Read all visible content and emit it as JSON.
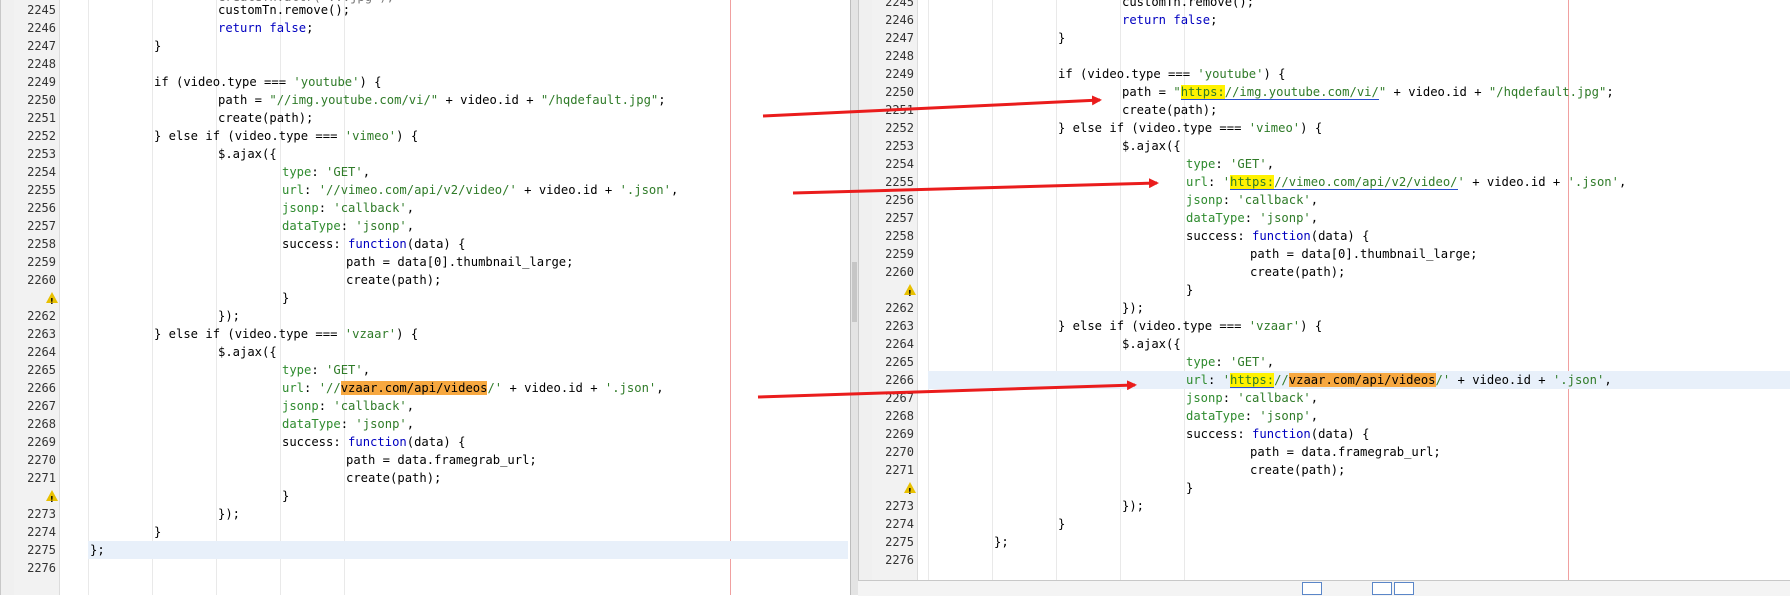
{
  "colors": {
    "keyword": "#0000c0",
    "string": "#2f7b28",
    "highlight_yellow": "#fff200",
    "highlight_orange": "#f7a840",
    "arrow": "#ea1c1c",
    "current_line": "#e8f0fa"
  },
  "left": {
    "top_partial": "createTn.attr('...jpg');",
    "lines": [
      {
        "n": "2245",
        "parts": [
          [
            "",
            "customTn.remove();"
          ]
        ],
        "indent": 2
      },
      {
        "n": "2246",
        "parts": [
          [
            "kw",
            "return false"
          ],
          [
            "",
            ";"
          ]
        ],
        "indent": 2
      },
      {
        "n": "2247",
        "parts": [
          [
            "",
            "}"
          ]
        ],
        "indent": 1
      },
      {
        "n": "2248",
        "parts": [],
        "indent": 0
      },
      {
        "n": "2249",
        "parts": [
          [
            "",
            "if (video.type === "
          ],
          [
            "str",
            "'youtube'"
          ],
          [
            "",
            ") {"
          ]
        ],
        "indent": 1
      },
      {
        "n": "2250",
        "parts": [
          [
            "",
            "path = "
          ],
          [
            "str",
            "\"//img.youtube.com/vi/\""
          ],
          [
            "",
            " + video.id + "
          ],
          [
            "str",
            "\"/hqdefault.jpg\""
          ],
          [
            "",
            ";"
          ]
        ],
        "indent": 2
      },
      {
        "n": "2251",
        "parts": [
          [
            "",
            "create(path);"
          ]
        ],
        "indent": 2
      },
      {
        "n": "2252",
        "parts": [
          [
            "",
            "} else if (video.type === "
          ],
          [
            "str",
            "'vimeo'"
          ],
          [
            "",
            ") {"
          ]
        ],
        "indent": 1
      },
      {
        "n": "2253",
        "parts": [
          [
            "",
            "$.ajax({"
          ]
        ],
        "indent": 2
      },
      {
        "n": "2254",
        "parts": [
          [
            "prop",
            "type"
          ],
          [
            "",
            ": "
          ],
          [
            "str",
            "'GET'"
          ],
          [
            "",
            ","
          ]
        ],
        "indent": 3
      },
      {
        "n": "2255",
        "parts": [
          [
            "prop",
            "url"
          ],
          [
            "",
            ": "
          ],
          [
            "str",
            "'//vimeo.com/api/v2/video/'"
          ],
          [
            "",
            " + video.id + "
          ],
          [
            "str",
            "'.json'"
          ],
          [
            "",
            ","
          ]
        ],
        "indent": 3
      },
      {
        "n": "2256",
        "parts": [
          [
            "prop",
            "jsonp"
          ],
          [
            "",
            ": "
          ],
          [
            "str",
            "'callback'"
          ],
          [
            "",
            ","
          ]
        ],
        "indent": 3
      },
      {
        "n": "2257",
        "parts": [
          [
            "prop",
            "dataType"
          ],
          [
            "",
            ": "
          ],
          [
            "str",
            "'jsonp'"
          ],
          [
            "",
            ","
          ]
        ],
        "indent": 3
      },
      {
        "n": "2258",
        "parts": [
          [
            "",
            "success: "
          ],
          [
            "kw",
            "function"
          ],
          [
            "",
            "(data) {"
          ]
        ],
        "indent": 3
      },
      {
        "n": "2259",
        "parts": [
          [
            "",
            "path = data[0].thumbnail_large;"
          ]
        ],
        "indent": 4
      },
      {
        "n": "2260",
        "parts": [
          [
            "",
            "create(path);"
          ]
        ],
        "indent": 4
      },
      {
        "n": "",
        "parts": [
          [
            "",
            "}"
          ]
        ],
        "indent": 3,
        "warn": true
      },
      {
        "n": "2262",
        "parts": [
          [
            "",
            "});"
          ]
        ],
        "indent": 2
      },
      {
        "n": "2263",
        "parts": [
          [
            "",
            "} else if (video.type === "
          ],
          [
            "str",
            "'vzaar'"
          ],
          [
            "",
            ") {"
          ]
        ],
        "indent": 1
      },
      {
        "n": "2264",
        "parts": [
          [
            "",
            "$.ajax({"
          ]
        ],
        "indent": 2
      },
      {
        "n": "2265",
        "parts": [
          [
            "prop",
            "type"
          ],
          [
            "",
            ": "
          ],
          [
            "str",
            "'GET'"
          ],
          [
            "",
            ","
          ]
        ],
        "indent": 3
      },
      {
        "n": "2266",
        "parts": [
          [
            "prop",
            "url"
          ],
          [
            "",
            ": "
          ],
          [
            "str",
            "'//"
          ],
          [
            "orange",
            "vzaar.com/api/videos"
          ],
          [
            "str",
            "/'"
          ],
          [
            "",
            " + video.id + "
          ],
          [
            "str",
            "'.json'"
          ],
          [
            "",
            ","
          ]
        ],
        "indent": 3
      },
      {
        "n": "2267",
        "parts": [
          [
            "prop",
            "jsonp"
          ],
          [
            "",
            ": "
          ],
          [
            "str",
            "'callback'"
          ],
          [
            "",
            ","
          ]
        ],
        "indent": 3
      },
      {
        "n": "2268",
        "parts": [
          [
            "prop",
            "dataType"
          ],
          [
            "",
            ": "
          ],
          [
            "str",
            "'jsonp'"
          ],
          [
            "",
            ","
          ]
        ],
        "indent": 3
      },
      {
        "n": "2269",
        "parts": [
          [
            "",
            "success: "
          ],
          [
            "kw",
            "function"
          ],
          [
            "",
            "(data) {"
          ]
        ],
        "indent": 3
      },
      {
        "n": "2270",
        "parts": [
          [
            "",
            "path = data.framegrab_url;"
          ]
        ],
        "indent": 4
      },
      {
        "n": "2271",
        "parts": [
          [
            "",
            "create(path);"
          ]
        ],
        "indent": 4
      },
      {
        "n": "",
        "parts": [
          [
            "",
            "}"
          ]
        ],
        "indent": 3,
        "warn": true
      },
      {
        "n": "2273",
        "parts": [
          [
            "",
            "});"
          ]
        ],
        "indent": 2
      },
      {
        "n": "2274",
        "parts": [
          [
            "",
            "}"
          ]
        ],
        "indent": 1
      },
      {
        "n": "2275",
        "parts": [
          [
            "",
            "};"
          ]
        ],
        "indent": 0,
        "current": true
      },
      {
        "n": "2276",
        "parts": [],
        "indent": 0
      }
    ]
  },
  "right": {
    "lines": [
      {
        "n": "2245",
        "parts": [
          [
            "",
            "customTn.remove();"
          ]
        ],
        "indent": 3
      },
      {
        "n": "2246",
        "parts": [
          [
            "kw",
            "return false"
          ],
          [
            "",
            ";"
          ]
        ],
        "indent": 3
      },
      {
        "n": "2247",
        "parts": [
          [
            "",
            "}"
          ]
        ],
        "indent": 2
      },
      {
        "n": "2248",
        "parts": [],
        "indent": 0
      },
      {
        "n": "2249",
        "parts": [
          [
            "",
            "if (video.type === "
          ],
          [
            "str",
            "'youtube'"
          ],
          [
            "",
            ") {"
          ]
        ],
        "indent": 2
      },
      {
        "n": "2250",
        "parts": [
          [
            "",
            "path = "
          ],
          [
            "str",
            "\""
          ],
          [
            "yellow",
            "https:"
          ],
          [
            "ulstr",
            "//img.youtube.com/vi/"
          ],
          [
            "str",
            "\""
          ],
          [
            "",
            " + video.id + "
          ],
          [
            "str",
            "\"/hqdefault.jpg\""
          ],
          [
            "",
            ";"
          ]
        ],
        "indent": 3
      },
      {
        "n": "2251",
        "parts": [
          [
            "",
            "create(path);"
          ]
        ],
        "indent": 3
      },
      {
        "n": "2252",
        "parts": [
          [
            "",
            "} else if (video.type === "
          ],
          [
            "str",
            "'vimeo'"
          ],
          [
            "",
            ") {"
          ]
        ],
        "indent": 2
      },
      {
        "n": "2253",
        "parts": [
          [
            "",
            "$.ajax({"
          ]
        ],
        "indent": 3
      },
      {
        "n": "2254",
        "parts": [
          [
            "prop",
            "type"
          ],
          [
            "",
            ": "
          ],
          [
            "str",
            "'GET'"
          ],
          [
            "",
            ","
          ]
        ],
        "indent": 4
      },
      {
        "n": "2255",
        "parts": [
          [
            "prop",
            "url"
          ],
          [
            "",
            ": "
          ],
          [
            "str",
            "'"
          ],
          [
            "yellow",
            "https:"
          ],
          [
            "ulstr",
            "//vimeo.com/api/v2/video/"
          ],
          [
            "str",
            "'"
          ],
          [
            "",
            " + video.id + "
          ],
          [
            "str",
            "'.json'"
          ],
          [
            "",
            ","
          ]
        ],
        "indent": 4
      },
      {
        "n": "2256",
        "parts": [
          [
            "prop",
            "jsonp"
          ],
          [
            "",
            ": "
          ],
          [
            "str",
            "'callback'"
          ],
          [
            "",
            ","
          ]
        ],
        "indent": 4
      },
      {
        "n": "2257",
        "parts": [
          [
            "prop",
            "dataType"
          ],
          [
            "",
            ": "
          ],
          [
            "str",
            "'jsonp'"
          ],
          [
            "",
            ","
          ]
        ],
        "indent": 4
      },
      {
        "n": "2258",
        "parts": [
          [
            "",
            "success: "
          ],
          [
            "kw",
            "function"
          ],
          [
            "",
            "(data) {"
          ]
        ],
        "indent": 4
      },
      {
        "n": "2259",
        "parts": [
          [
            "",
            "path = data[0].thumbnail_large;"
          ]
        ],
        "indent": 5
      },
      {
        "n": "2260",
        "parts": [
          [
            "",
            "create(path);"
          ]
        ],
        "indent": 5
      },
      {
        "n": "",
        "parts": [
          [
            "",
            "}"
          ]
        ],
        "indent": 4,
        "warn": true
      },
      {
        "n": "2262",
        "parts": [
          [
            "",
            "});"
          ]
        ],
        "indent": 3
      },
      {
        "n": "2263",
        "parts": [
          [
            "",
            "} else if (video.type === "
          ],
          [
            "str",
            "'vzaar'"
          ],
          [
            "",
            ") {"
          ]
        ],
        "indent": 2
      },
      {
        "n": "2264",
        "parts": [
          [
            "",
            "$.ajax({"
          ]
        ],
        "indent": 3
      },
      {
        "n": "2265",
        "parts": [
          [
            "prop",
            "type"
          ],
          [
            "",
            ": "
          ],
          [
            "str",
            "'GET'"
          ],
          [
            "",
            ","
          ]
        ],
        "indent": 4
      },
      {
        "n": "2266",
        "parts": [
          [
            "prop",
            "url"
          ],
          [
            "",
            ": "
          ],
          [
            "str",
            "'"
          ],
          [
            "yellow",
            "https:"
          ],
          [
            "str",
            "//"
          ],
          [
            "orange",
            "vzaar.com/api/videos"
          ],
          [
            "str",
            "/'"
          ],
          [
            "",
            " + video.id + "
          ],
          [
            "str",
            "'.json'"
          ],
          [
            "",
            ","
          ]
        ],
        "indent": 4,
        "current": true
      },
      {
        "n": "2267",
        "parts": [
          [
            "prop",
            "jsonp"
          ],
          [
            "",
            ": "
          ],
          [
            "str",
            "'callback'"
          ],
          [
            "",
            ","
          ]
        ],
        "indent": 4
      },
      {
        "n": "2268",
        "parts": [
          [
            "prop",
            "dataType"
          ],
          [
            "",
            ": "
          ],
          [
            "str",
            "'jsonp'"
          ],
          [
            "",
            ","
          ]
        ],
        "indent": 4
      },
      {
        "n": "2269",
        "parts": [
          [
            "",
            "success: "
          ],
          [
            "kw",
            "function"
          ],
          [
            "",
            "(data) {"
          ]
        ],
        "indent": 4
      },
      {
        "n": "2270",
        "parts": [
          [
            "",
            "path = data.framegrab_url;"
          ]
        ],
        "indent": 5
      },
      {
        "n": "2271",
        "parts": [
          [
            "",
            "create(path);"
          ]
        ],
        "indent": 5
      },
      {
        "n": "",
        "parts": [
          [
            "",
            "}"
          ]
        ],
        "indent": 4,
        "warn": true
      },
      {
        "n": "2273",
        "parts": [
          [
            "",
            "});"
          ]
        ],
        "indent": 3
      },
      {
        "n": "2274",
        "parts": [
          [
            "",
            "}"
          ]
        ],
        "indent": 2
      },
      {
        "n": "2275",
        "parts": [
          [
            "",
            "};"
          ]
        ],
        "indent": 1
      },
      {
        "n": "2276",
        "parts": [],
        "indent": 0
      }
    ]
  }
}
